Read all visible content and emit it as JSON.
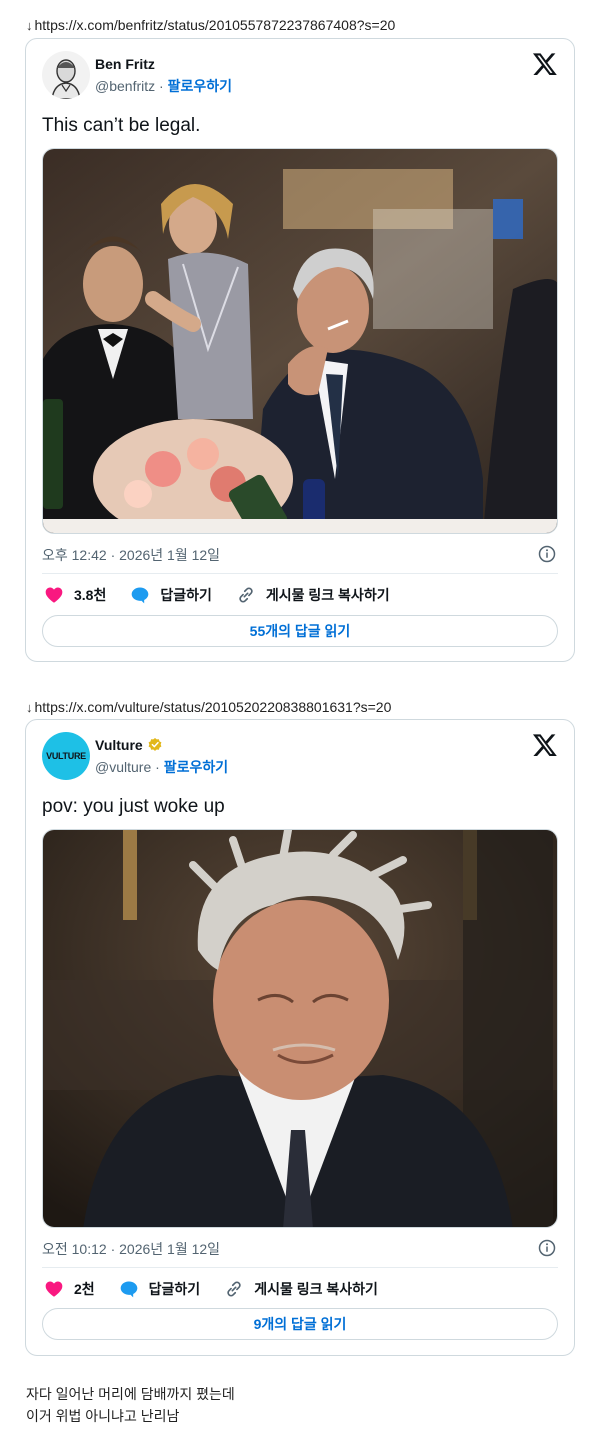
{
  "tweets": [
    {
      "source_url": "https://x.com/benfritz/status/2010557872237867408?s=20",
      "author_name": "Ben Fritz",
      "handle": "@benfritz",
      "follow_label": "팔로우하기",
      "text": "This can’t be legal.",
      "timestamp": "오후 12:42 · 2026년 1월 12일",
      "likes": "3.8천",
      "reply_label": "답글하기",
      "copy_link_label": "게시물 링크 복사하기",
      "read_replies_label": "55개의 답글 읽기"
    },
    {
      "source_url": "https://x.com/vulture/status/2010520220838801631?s=20",
      "author_name": "Vulture",
      "handle": "@vulture",
      "avatar_text": "VULTURE",
      "follow_label": "팔로우하기",
      "text": "pov: you just woke up",
      "timestamp": "오전 10:12 · 2026년 1월 12일",
      "likes": "2천",
      "reply_label": "답글하기",
      "copy_link_label": "게시물 링크 복사하기",
      "read_replies_label": "9개의 답글 읽기"
    }
  ],
  "caption_lines": [
    "자다 일어난 머리에 담배까지 폈는데",
    "이거 위법 아니냐고 난리남"
  ],
  "colors": {
    "link_blue": "#006fd6",
    "heart_pink": "#f91880",
    "reply_blue": "#1d9bf0",
    "verified_gold": "#e2b719",
    "vulture_teal": "#1ec0e6"
  }
}
